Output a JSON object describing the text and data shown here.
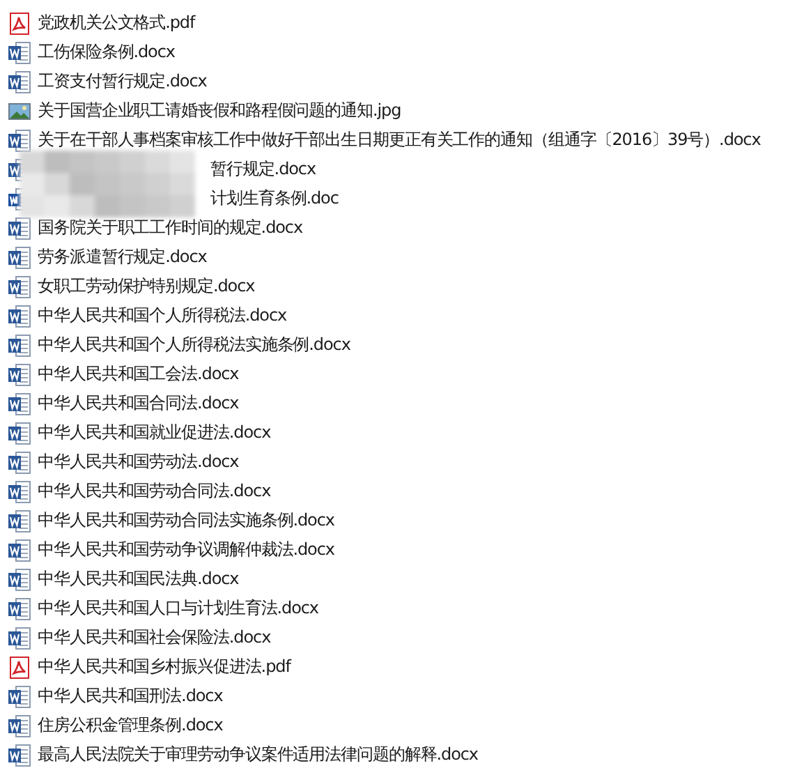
{
  "files": [
    {
      "kind": "pdf",
      "name": "党政机关公文格式.pdf",
      "obscured": false
    },
    {
      "kind": "word",
      "name": "工伤保险条例.docx",
      "obscured": false
    },
    {
      "kind": "word",
      "name": "工资支付暂行规定.docx",
      "obscured": false
    },
    {
      "kind": "image",
      "name": "关于国营企业职工请婚丧假和路程假问题的通知.jpg",
      "obscured": false
    },
    {
      "kind": "word",
      "name": "关于在干部人事档案审核工作中做好干部出生日期更正有关工作的通知（组通字〔2016〕39号）.docx",
      "obscured": false
    },
    {
      "kind": "word",
      "name": "暂行规定.docx",
      "obscured": true
    },
    {
      "kind": "word-legacy",
      "name": "计划生育条例.doc",
      "obscured": true
    },
    {
      "kind": "word",
      "name": "国务院关于职工工作时间的规定.docx",
      "obscured": false
    },
    {
      "kind": "word",
      "name": "劳务派遣暂行规定.docx",
      "obscured": false
    },
    {
      "kind": "word",
      "name": "女职工劳动保护特别规定.docx",
      "obscured": false
    },
    {
      "kind": "word",
      "name": "中华人民共和国个人所得税法.docx",
      "obscured": false
    },
    {
      "kind": "word",
      "name": "中华人民共和国个人所得税法实施条例.docx",
      "obscured": false
    },
    {
      "kind": "word",
      "name": "中华人民共和国工会法.docx",
      "obscured": false
    },
    {
      "kind": "word",
      "name": "中华人民共和国合同法.docx",
      "obscured": false
    },
    {
      "kind": "word",
      "name": "中华人民共和国就业促进法.docx",
      "obscured": false
    },
    {
      "kind": "word",
      "name": "中华人民共和国劳动法.docx",
      "obscured": false
    },
    {
      "kind": "word",
      "name": "中华人民共和国劳动合同法.docx",
      "obscured": false
    },
    {
      "kind": "word",
      "name": "中华人民共和国劳动合同法实施条例.docx",
      "obscured": false
    },
    {
      "kind": "word",
      "name": "中华人民共和国劳动争议调解仲裁法.docx",
      "obscured": false
    },
    {
      "kind": "word",
      "name": "中华人民共和国民法典.docx",
      "obscured": false
    },
    {
      "kind": "word",
      "name": "中华人民共和国人口与计划生育法.docx",
      "obscured": false
    },
    {
      "kind": "word",
      "name": "中华人民共和国社会保险法.docx",
      "obscured": false
    },
    {
      "kind": "pdf",
      "name": "中华人民共和国乡村振兴促进法.pdf",
      "obscured": false
    },
    {
      "kind": "word",
      "name": "中华人民共和国刑法.docx",
      "obscured": false
    },
    {
      "kind": "word",
      "name": "住房公积金管理条例.docx",
      "obscured": false
    },
    {
      "kind": "word",
      "name": "最高人民法院关于审理劳动争议案件适用法律问题的解释.docx",
      "obscured": false
    }
  ]
}
